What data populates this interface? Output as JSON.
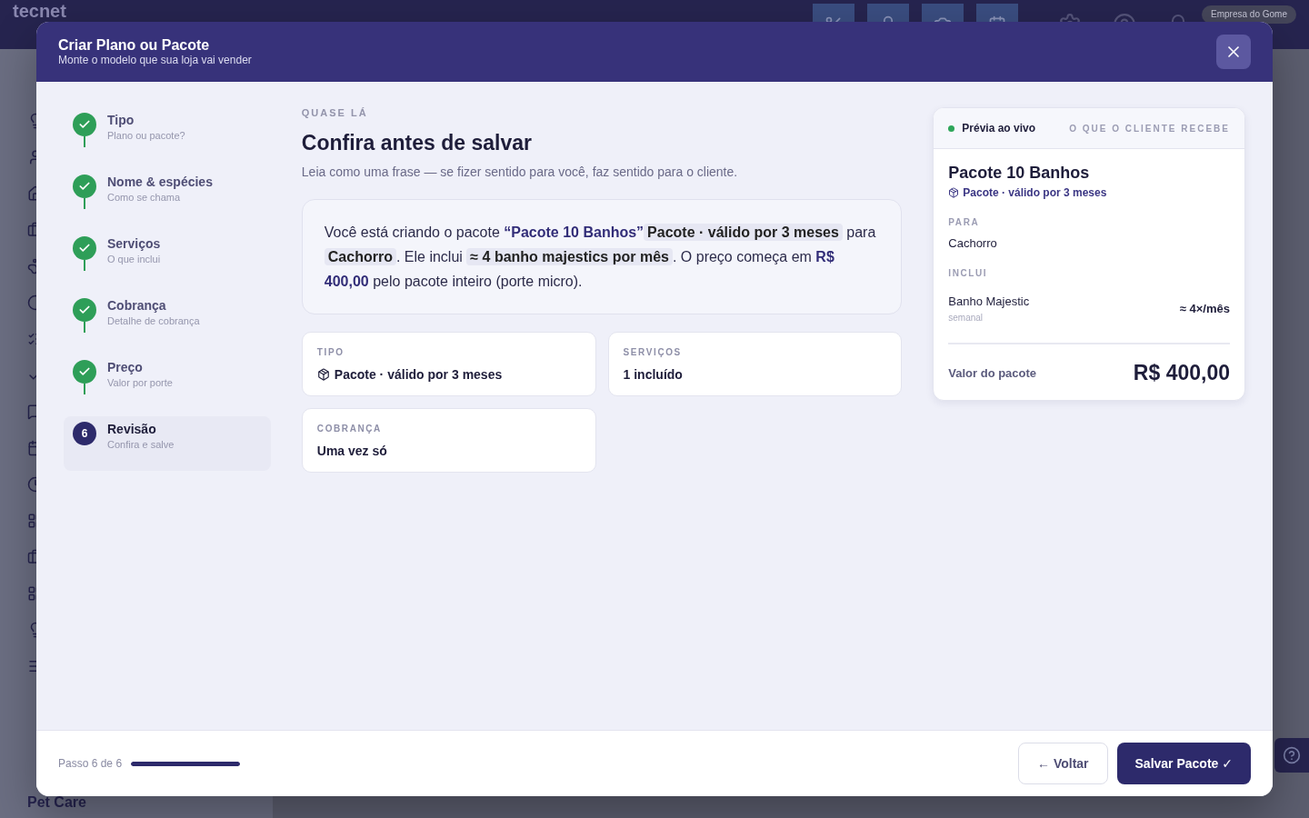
{
  "app": {
    "logo": "tecnet",
    "company": "Empresa do Gome",
    "footer_label": "Pet Care"
  },
  "modal": {
    "title": "Criar Plano ou Pacote",
    "subtitle": "Monte o modelo que sua loja vai vender"
  },
  "steps": [
    {
      "title": "Tipo",
      "subtitle": "Plano ou pacote?",
      "done": true,
      "selected": false
    },
    {
      "title": "Nome & espécies",
      "subtitle": "Como se chama",
      "done": true,
      "selected": false
    },
    {
      "title": "Serviços",
      "subtitle": "O que inclui",
      "done": true,
      "selected": false
    },
    {
      "title": "Cobrança",
      "subtitle": "Detalhe de cobrança",
      "done": true,
      "selected": false
    },
    {
      "title": "Preço",
      "subtitle": "Valor por porte",
      "done": true,
      "selected": false
    },
    {
      "title": "Revisão",
      "subtitle": "Confira e salve",
      "done": false,
      "selected": true,
      "badge": "6"
    }
  ],
  "review": {
    "eyebrow": "QUASE LÁ",
    "heading": "Confira antes de salvar",
    "lead": "Leia como uma frase — se fizer sentido para você, faz sentido para o cliente.",
    "sentence": [
      {
        "kind": "text",
        "text": "Você está criando o pacote "
      },
      {
        "kind": "accent",
        "text": "“Pacote 10 Banhos”"
      },
      {
        "kind": "chip",
        "text": "Pacote · válido por 3 meses"
      },
      {
        "kind": "text",
        "text": " para "
      },
      {
        "kind": "chip",
        "text": "Cachorro"
      },
      {
        "kind": "text",
        "text": ". Ele inclui "
      },
      {
        "kind": "chip",
        "text": "≈ 4 banho majestics por mês"
      },
      {
        "kind": "text",
        "text": ". O preço começa em "
      },
      {
        "kind": "accent",
        "text": "R$ 400,00"
      },
      {
        "kind": "text",
        "text": " pelo pacote inteiro (porte micro)."
      }
    ],
    "cards": [
      {
        "label": "TIPO",
        "value": "Pacote · válido por 3 meses",
        "kind": "type"
      },
      {
        "label": "SERVIÇOS",
        "value": "1 incluído",
        "kind": "plain"
      },
      {
        "label": "COBRANÇA",
        "value": "Uma vez só",
        "kind": "plain"
      }
    ]
  },
  "preview": {
    "live_label": "Prévia ao vivo",
    "live": true,
    "caption": "O QUE O CLIENTE RECEBE",
    "name": "Pacote 10 Banhos",
    "type": "Pacote · válido por 3 meses",
    "for_label": "PARA",
    "for_value": "Cachorro",
    "includes_label": "INCLUI",
    "items": [
      {
        "name": "Banho Majestic",
        "note": "semanal",
        "qty": "≈ 4×/mês"
      }
    ],
    "total_label": "Valor do pacote",
    "total": "R$ 400,00"
  },
  "footer": {
    "step_text": "Passo 6 de 6",
    "level": 1,
    "back": "← Voltar",
    "save": "Salvar Pacote ✓"
  }
}
